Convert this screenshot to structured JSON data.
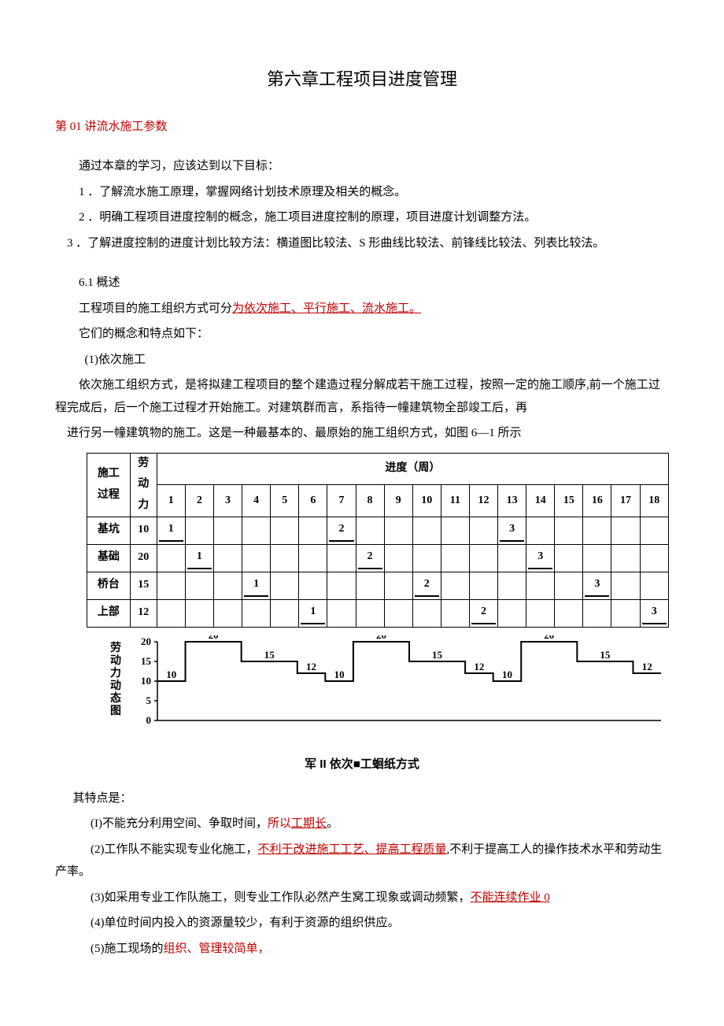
{
  "title": "第六章工程项目进度管理",
  "section_heading": "第 01 讲流水施工参数",
  "intro": "通过本章的学习，应该达到以下目标：",
  "goals": [
    "1 ．了解流水施工原理，掌握网络计划技术原理及相关的概念。",
    "2 ．明确工程项目进度控制的概念，施工项目进度控制的原理，项目进度计划调整方法。",
    "3 ．了解进度控制的进度计划比较方法：横道图比较法、S 形曲线比较法、前锋线比较法、列表比较法。"
  ],
  "sub_section": "6.1 概述",
  "p_method_pre": "工程项目的施工组织方式可分",
  "p_method_red": "为依次施工、平行施工、流水施工。",
  "p_concept": "它们的概念和特点如下：",
  "seq_label": "(1)依次施工",
  "seq_desc1": "依次施工组织方式，是将拟建工程项目的整个建造过程分解成若干施工过程，按照一定的施工顺序,前一个施工过程完成后，后一个施工过程才开始施工。对建筑群而言，系指待一幢建筑物全部竣工后，再",
  "seq_desc2": "进行另一幢建筑物的施工。这是一种最基本的、最原始的施工组织方式，如图 6—1 所示",
  "gantt": {
    "header_proc": "施工过程",
    "header_labor": "劳动力",
    "header_progress": "进度（周）",
    "weeks": [
      "1",
      "2",
      "3",
      "4",
      "5",
      "6",
      "7",
      "8",
      "9",
      "10",
      "11",
      "12",
      "13",
      "14",
      "15",
      "16",
      "17",
      "18"
    ],
    "rows": [
      {
        "name": "基坑",
        "labor": "10",
        "bars": [
          {
            "start": 1,
            "label": "1"
          },
          {
            "start": 7,
            "label": "2"
          },
          {
            "start": 13,
            "label": "3"
          }
        ]
      },
      {
        "name": "基础",
        "labor": "20",
        "bars": [
          {
            "start": 2,
            "label": "1"
          },
          {
            "start": 8,
            "label": "2"
          },
          {
            "start": 14,
            "label": "3"
          }
        ]
      },
      {
        "name": "桥台",
        "labor": "15",
        "bars": [
          {
            "start": 4,
            "label": "1"
          },
          {
            "start": 10,
            "label": "2"
          },
          {
            "start": 16,
            "label": "3"
          }
        ]
      },
      {
        "name": "上部",
        "labor": "12",
        "bars": [
          {
            "start": 6,
            "label": "1"
          },
          {
            "start": 12,
            "label": "2"
          },
          {
            "start": 18,
            "label": "3"
          }
        ]
      }
    ]
  },
  "labor_chart": {
    "ylabel": "劳动力动态图",
    "yticks": [
      "20",
      "15",
      "10",
      "5",
      "0"
    ]
  },
  "chart_data": {
    "type": "bar",
    "title": "劳动力动态图",
    "xlabel": "进度（周）",
    "ylabel": "劳动力",
    "ylim": [
      0,
      20
    ],
    "categories": [
      1,
      2,
      3,
      4,
      5,
      6,
      7,
      8,
      9,
      10,
      11,
      12,
      13,
      14,
      15,
      16,
      17,
      18
    ],
    "values": [
      10,
      20,
      20,
      15,
      15,
      12,
      10,
      20,
      20,
      15,
      15,
      12,
      10,
      20,
      20,
      15,
      15,
      12
    ]
  },
  "caption": "军 II 依次■工蛔纸方式",
  "features_intro": "其特点是：",
  "features": [
    {
      "pre": "(I)不能充分利用空间、争取时间，",
      "red": "所以",
      "redu": "工期长",
      "post": "。"
    },
    {
      "pre": "(2)工作队不能实现专业化施工，",
      "redu": "不利于改进施工工艺、提高工程质量",
      "post": ",不利于提高工人的操作技术水平和劳动生产率。"
    },
    {
      "pre": "(3)如采用专业工作队施工，则专业工作队必然产生窝工现象或调动频繁，",
      "redu": "不能连续作业 0",
      "post": ""
    },
    {
      "pre": "(4)单位时间内投入的资源量较少，有利于资源的组织供应。",
      "redu": "",
      "post": ""
    },
    {
      "pre": "(5)施工现场的",
      "red": "组织、管理较简单，",
      "post": ""
    }
  ]
}
